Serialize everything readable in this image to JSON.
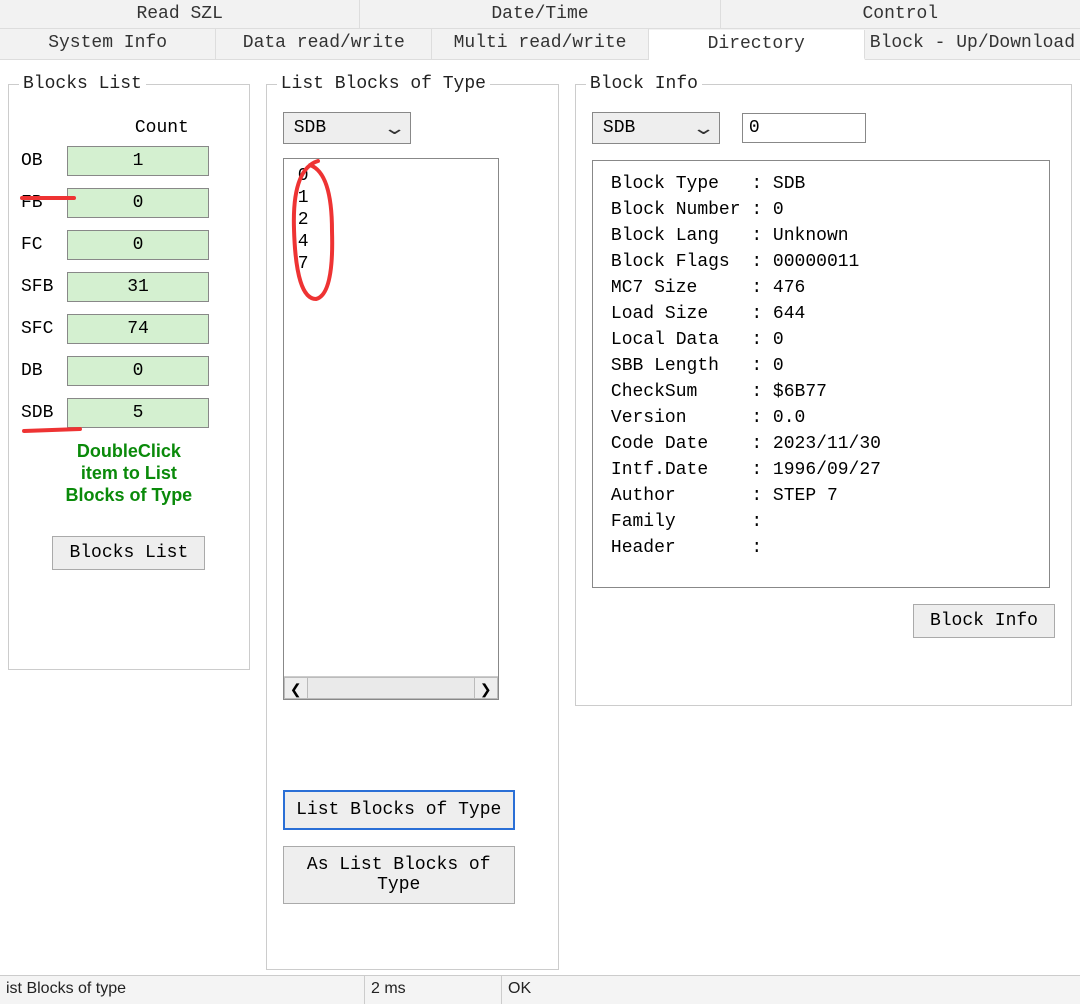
{
  "tabs_top": [
    "Read SZL",
    "Date/Time",
    "Control"
  ],
  "tabs_bottom": [
    "System Info",
    "Data read/write",
    "Multi read/write",
    "Directory",
    "Block - Up/Download"
  ],
  "active_tab": "Directory",
  "blocks_list": {
    "legend": "Blocks List",
    "count_header": "Count",
    "rows": [
      {
        "label": "OB",
        "value": "1"
      },
      {
        "label": "FB",
        "value": "0"
      },
      {
        "label": "FC",
        "value": "0"
      },
      {
        "label": "SFB",
        "value": "31"
      },
      {
        "label": "SFC",
        "value": "74"
      },
      {
        "label": "DB",
        "value": "0"
      },
      {
        "label": "SDB",
        "value": "5"
      }
    ],
    "hint_line1": "DoubleClick",
    "hint_line2": "item to List",
    "hint_line3": "Blocks of Type",
    "button": "Blocks List"
  },
  "list_blocks": {
    "legend": "List Blocks of Type",
    "select_value": "SDB",
    "items": [
      "0",
      "1",
      "2",
      "4",
      "7"
    ],
    "button_primary": "List Blocks of Type",
    "button_secondary": "As List Blocks of Type"
  },
  "block_info": {
    "legend": "Block Info",
    "select_value": "SDB",
    "number_value": "0",
    "fields": [
      {
        "k": "Block Type",
        "v": "SDB"
      },
      {
        "k": "Block Number",
        "v": "0"
      },
      {
        "k": "Block Lang",
        "v": "Unknown"
      },
      {
        "k": "Block Flags",
        "v": "00000011"
      },
      {
        "k": "MC7 Size",
        "v": "476"
      },
      {
        "k": "Load Size",
        "v": "644"
      },
      {
        "k": "Local Data",
        "v": "0"
      },
      {
        "k": "SBB Length",
        "v": "0"
      },
      {
        "k": "CheckSum",
        "v": "$6B77"
      },
      {
        "k": "Version",
        "v": "0.0"
      },
      {
        "k": "Code Date",
        "v": "2023/11/30"
      },
      {
        "k": "Intf.Date",
        "v": "1996/09/27"
      },
      {
        "k": "Author",
        "v": "STEP 7"
      },
      {
        "k": "Family",
        "v": ""
      },
      {
        "k": "Header",
        "v": ""
      }
    ],
    "button": "Block Info"
  },
  "status": {
    "action": "ist Blocks of type",
    "time": "2 ms",
    "result": "OK"
  },
  "colors": {
    "green_cell": "#d4f0d0",
    "hint_text": "#0a8a0a",
    "annotate_red": "#e33",
    "btn_highlight": "#2a6fd6"
  }
}
